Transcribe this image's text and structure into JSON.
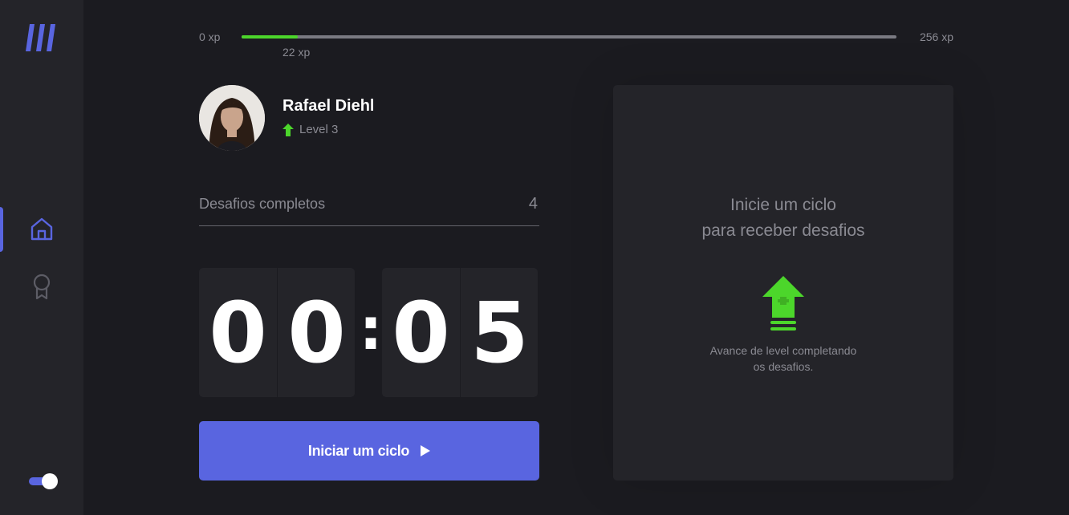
{
  "sidebar": {
    "logo_icon": "moveit-logo-icon",
    "nav": [
      {
        "name": "home",
        "icon": "home-icon",
        "active": true
      },
      {
        "name": "awards",
        "icon": "award-icon",
        "active": false
      }
    ],
    "theme_toggle": {
      "icon": "toggle-icon",
      "enabled": true
    }
  },
  "xp": {
    "min_label": "0 xp",
    "max_label": "256 xp",
    "current_label": "22 xp",
    "current": 22,
    "max": 256,
    "fill_fraction": 0.086
  },
  "profile": {
    "name": "Rafael Diehl",
    "level_label": "Level 3",
    "level_icon": "level-up-arrow-icon"
  },
  "challenges": {
    "label": "Desafios completos",
    "count": "4"
  },
  "countdown": {
    "minute_left": "0",
    "minute_right": "0",
    "separator": ":",
    "second_left": "0",
    "second_right": "5"
  },
  "start_button": {
    "label": "Iniciar um ciclo",
    "icon": "play-icon"
  },
  "challenge_panel": {
    "title_line1": "Inicie um ciclo",
    "title_line2": "para receber desafios",
    "icon": "level-up-icon",
    "desc_line1": "Avance de level completando",
    "desc_line2": "os desafios."
  },
  "colors": {
    "accent": "#5965e0",
    "green": "#4cd62b",
    "background": "#1b1b20",
    "panel": "#242429",
    "text_muted": "#8a8a92"
  }
}
